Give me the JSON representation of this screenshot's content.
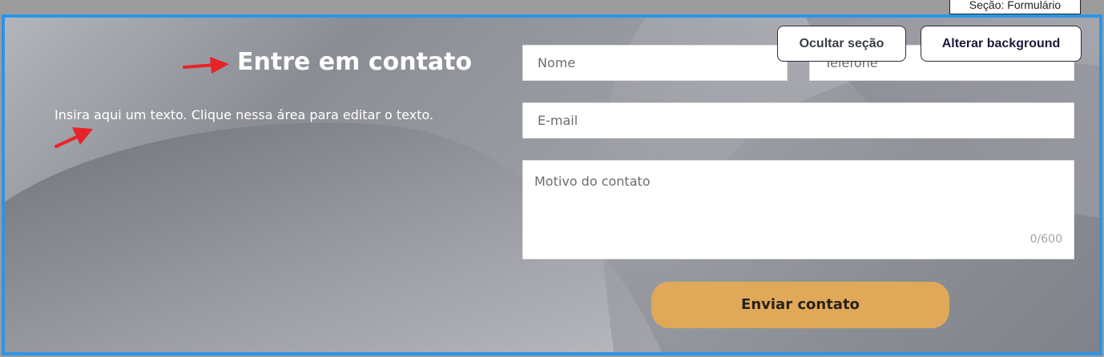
{
  "section_label": "Seção: Formulário",
  "toolbar": {
    "hide_section_label": "Ocultar seção",
    "change_background_label": "Alterar background"
  },
  "content": {
    "title": "Entre em contato",
    "subtitle": "Insira aqui um texto. Clique nessa área para editar o texto."
  },
  "form": {
    "name_placeholder": "Nome",
    "phone_placeholder": "Telefone",
    "email_placeholder": "E-mail",
    "reason_placeholder": "Motivo do contato",
    "reason_counter": "0/600",
    "submit_label": "Enviar contato"
  },
  "colors": {
    "selection_border": "#2a95e9",
    "submit_button": "#e0a95a",
    "annotation_arrow": "#e8232a"
  }
}
